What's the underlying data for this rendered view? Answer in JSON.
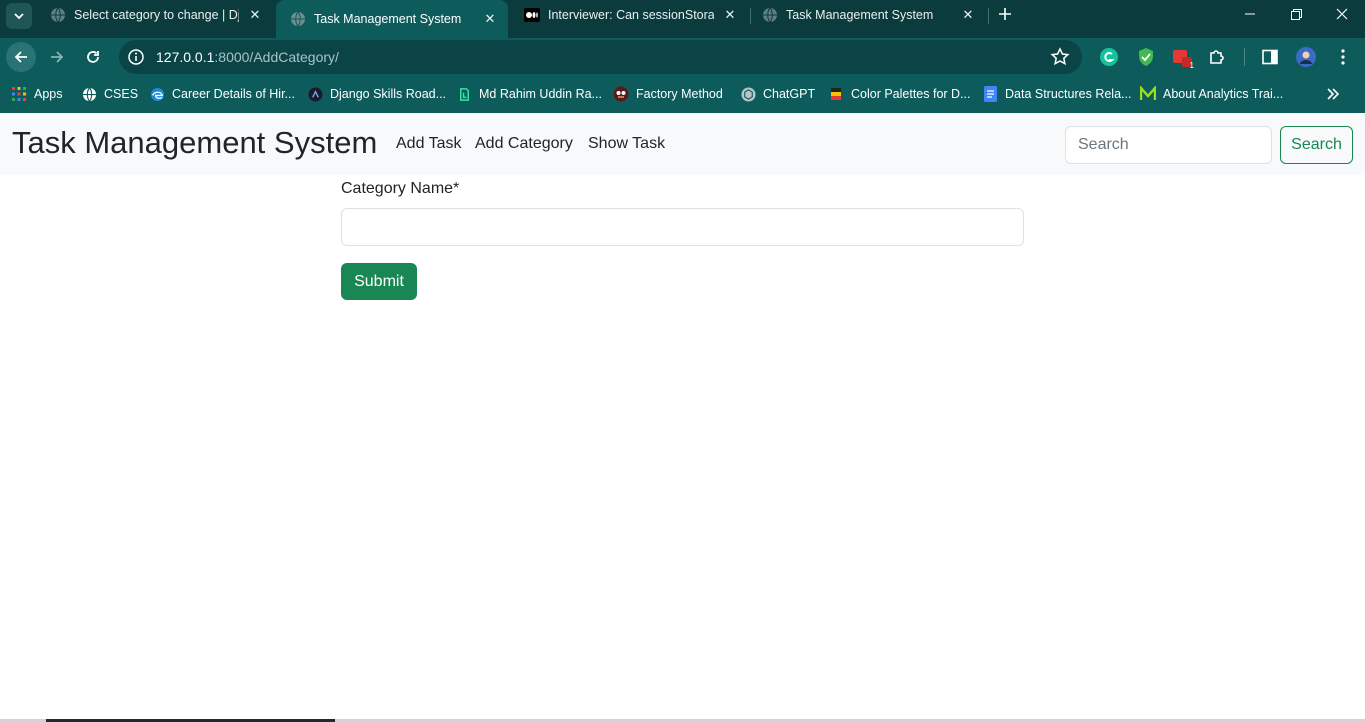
{
  "browser": {
    "tabs": [
      {
        "title": "Select category to change | Django site admin",
        "favicon": "globe-icon",
        "active": false
      },
      {
        "title": "Task Management System",
        "favicon": "globe-icon",
        "active": true
      },
      {
        "title": "Interviewer: Can sessionStorage share data",
        "favicon": "medium-icon",
        "active": false
      },
      {
        "title": "Task Management System",
        "favicon": "globe-icon",
        "active": false
      }
    ],
    "url_host": "127.0.0.1",
    "url_rest": ":8000/AddCategory/",
    "bookmarks": [
      {
        "label": "Apps",
        "icon": "apps-grid-icon"
      },
      {
        "label": "CSES",
        "icon": "globe-icon"
      },
      {
        "label": "Career Details of Hir...",
        "icon": "edge-icon"
      },
      {
        "label": "Django Skills Road...",
        "icon": "roadmap-icon"
      },
      {
        "label": "Md Rahim Uddin Ra...",
        "icon": "leetcode-icon"
      },
      {
        "label": "Factory Method",
        "icon": "refactoring-guru-icon"
      },
      {
        "label": "ChatGPT",
        "icon": "chatgpt-icon"
      },
      {
        "label": "Color Palettes for D...",
        "icon": "palette-icon"
      },
      {
        "label": "Data Structures Rela...",
        "icon": "docs-icon"
      },
      {
        "label": "About Analytics Trai...",
        "icon": "m-logo-icon"
      }
    ],
    "extension_badge": "1"
  },
  "page": {
    "brand": "Task Management System",
    "nav": [
      "Add Task",
      "Add Category",
      "Show Task"
    ],
    "search_placeholder": "Search",
    "search_button": "Search",
    "form": {
      "label": "Category Name*",
      "value": "",
      "submit": "Submit"
    }
  },
  "colors": {
    "chrome_dark": "#0b3b3d",
    "chrome": "#0e5b5c",
    "success": "#198754",
    "navbar_bg": "#f8f9fa"
  }
}
